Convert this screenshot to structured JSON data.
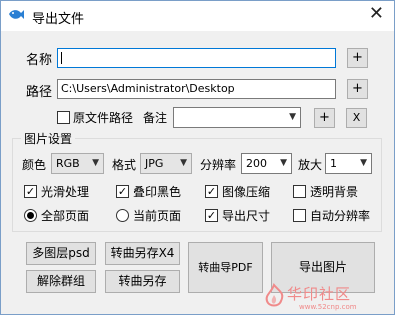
{
  "window": {
    "title": "导出文件",
    "close_symbol": "✕"
  },
  "name_row": {
    "label": "名称",
    "value": "",
    "add": "+"
  },
  "path_row": {
    "label": "路径",
    "value": "C:\\Users\\Administrator\\Desktop",
    "add": "+"
  },
  "note_row": {
    "orig_path_label": "原文件路径",
    "orig_path_checked": false,
    "note_label": "备注",
    "note_value": "",
    "add": "+",
    "remove": "X"
  },
  "image_settings": {
    "title": "图片设置",
    "color_label": "颜色",
    "color_value": "RGB",
    "format_label": "格式",
    "format_value": "JPG",
    "dpi_label": "分辨率",
    "dpi_value": "200",
    "zoom_label": "放大",
    "zoom_value": "1",
    "checkboxes": [
      {
        "label": "光滑处理",
        "checked": true
      },
      {
        "label": "叠印黑色",
        "checked": true
      },
      {
        "label": "图像压缩",
        "checked": true
      },
      {
        "label": "透明背景",
        "checked": false
      },
      {
        "label": "导出尺寸",
        "checked": true
      },
      {
        "label": "自动分辨率",
        "checked": false
      }
    ],
    "radios": [
      {
        "label": "全部页面",
        "selected": true
      },
      {
        "label": "当前页面",
        "selected": false
      }
    ]
  },
  "actions": {
    "multi_layer_psd": "多图层psd",
    "curve_save_x4": "转曲另存X4",
    "ungroup": "解除群组",
    "curve_save": "转曲另存",
    "curve_pdf": "转曲导PDF",
    "export_image": "导出图片"
  },
  "watermark": {
    "text": "华印社区",
    "url": "www.52cnp.com"
  },
  "colors": {
    "accent": "#0078d7",
    "watermark": "#f08a8a"
  }
}
